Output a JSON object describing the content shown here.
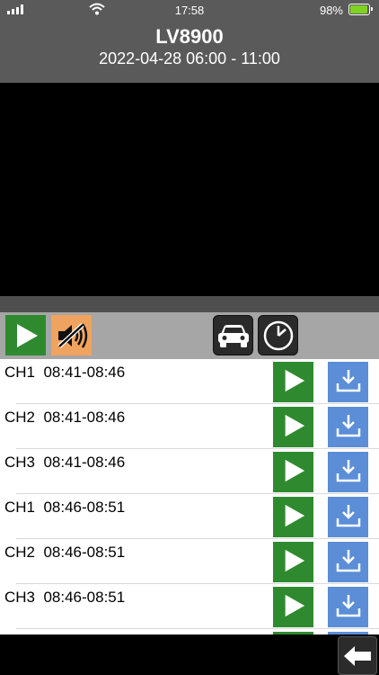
{
  "status_bar": {
    "time": "17:58",
    "battery_percent": "98%",
    "battery_level": 0.98,
    "icons": [
      "signal-icon",
      "wifi-icon",
      "battery-charging-icon"
    ]
  },
  "header": {
    "title": "LV8900",
    "subtitle": "2022-04-28 06:00 - 11:00"
  },
  "toolbar": {
    "icons": [
      "play-icon",
      "speaker-muted-icon",
      "car-icon",
      "clock-icon"
    ]
  },
  "recordings": [
    {
      "channel": "CH1",
      "range": "08:41-08:46"
    },
    {
      "channel": "CH2",
      "range": "08:41-08:46"
    },
    {
      "channel": "CH3",
      "range": "08:41-08:46"
    },
    {
      "channel": "CH1",
      "range": "08:46-08:51"
    },
    {
      "channel": "CH2",
      "range": "08:46-08:51"
    },
    {
      "channel": "CH3",
      "range": "08:46-08:51"
    }
  ],
  "colors": {
    "header_bg": "#5a5a5a",
    "play_green": "#2f8a2f",
    "download_blue": "#5b8ed6",
    "mute_orange": "#f0a35e",
    "toolbar_bg": "#a6a6a6"
  }
}
